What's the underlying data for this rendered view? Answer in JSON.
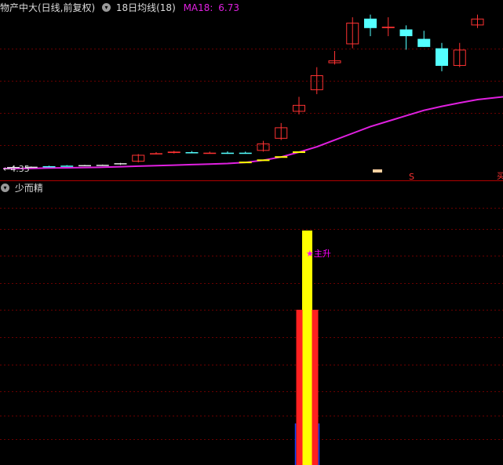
{
  "top_panel": {
    "title": "物产中大(日线,前复权)",
    "indicator_name": "18日均线(18)",
    "ma_label": "MA18:",
    "ma_value": "6.73",
    "price_marker": "←4.35",
    "s_marker": "S",
    "right_marker": "买",
    "ma_color": "#e020e0",
    "up_color": "#ff3232",
    "down_color": "#54ffff"
  },
  "bottom_panel": {
    "title": "少而精",
    "signal_label": "★主升",
    "signal_color": "#ff00ff",
    "bar_colors": {
      "outer": "#ff2020",
      "inner": "#ffff00",
      "base": "#1040ff"
    }
  },
  "icons": {
    "collapse": "chevron-down-icon"
  },
  "chart_data": {
    "type": "candlestick",
    "candles": [
      {
        "o": 4.35,
        "h": 4.36,
        "l": 4.33,
        "c": 4.35,
        "dir": "flat"
      },
      {
        "o": 4.36,
        "h": 4.37,
        "l": 4.34,
        "c": 4.36,
        "dir": "flat"
      },
      {
        "o": 4.37,
        "h": 4.4,
        "l": 4.35,
        "c": 4.38,
        "dir": "down"
      },
      {
        "o": 4.4,
        "h": 4.42,
        "l": 4.38,
        "c": 4.39,
        "dir": "down"
      },
      {
        "o": 4.41,
        "h": 4.43,
        "l": 4.39,
        "c": 4.42,
        "dir": "flat"
      },
      {
        "o": 4.42,
        "h": 4.44,
        "l": 4.4,
        "c": 4.43,
        "dir": "flat"
      },
      {
        "o": 4.45,
        "h": 4.5,
        "l": 4.43,
        "c": 4.49,
        "dir": "flat"
      },
      {
        "o": 4.55,
        "h": 4.83,
        "l": 4.52,
        "c": 4.8,
        "dir": "up"
      },
      {
        "o": 4.85,
        "h": 4.9,
        "l": 4.83,
        "c": 4.86,
        "dir": "up"
      },
      {
        "o": 4.87,
        "h": 4.95,
        "l": 4.85,
        "c": 4.92,
        "dir": "up"
      },
      {
        "o": 4.9,
        "h": 4.94,
        "l": 4.86,
        "c": 4.88,
        "dir": "down"
      },
      {
        "o": 4.88,
        "h": 4.92,
        "l": 4.85,
        "c": 4.87,
        "dir": "up"
      },
      {
        "o": 4.88,
        "h": 4.93,
        "l": 4.84,
        "c": 4.86,
        "dir": "down"
      },
      {
        "o": 4.87,
        "h": 4.92,
        "l": 4.85,
        "c": 4.88,
        "dir": "down"
      },
      {
        "o": 4.95,
        "h": 5.32,
        "l": 4.92,
        "c": 5.22,
        "dir": "up"
      },
      {
        "o": 5.4,
        "h": 5.98,
        "l": 5.35,
        "c": 5.82,
        "dir": "up"
      },
      {
        "o": 6.4,
        "h": 6.95,
        "l": 6.3,
        "c": 6.65,
        "dir": "up"
      },
      {
        "o": 7.2,
        "h": 8.05,
        "l": 7.05,
        "c": 7.75,
        "dir": "up"
      },
      {
        "o": 8.2,
        "h": 8.65,
        "l": 8.15,
        "c": 8.3,
        "dir": "up"
      },
      {
        "o": 8.9,
        "h": 9.9,
        "l": 8.75,
        "c": 9.7,
        "dir": "up"
      },
      {
        "o": 9.85,
        "h": 10.0,
        "l": 9.2,
        "c": 9.5,
        "dir": "down"
      },
      {
        "o": 9.5,
        "h": 9.9,
        "l": 9.2,
        "c": 9.55,
        "dir": "up"
      },
      {
        "o": 9.45,
        "h": 9.6,
        "l": 8.7,
        "c": 9.2,
        "dir": "down"
      },
      {
        "o": 9.1,
        "h": 9.4,
        "l": 8.8,
        "c": 8.8,
        "dir": "down"
      },
      {
        "o": 8.75,
        "h": 8.95,
        "l": 7.9,
        "c": 8.1,
        "dir": "down"
      },
      {
        "o": 8.1,
        "h": 8.95,
        "l": 8.05,
        "c": 8.7,
        "dir": "up"
      },
      {
        "o": 9.6,
        "h": 10.0,
        "l": 9.5,
        "c": 9.85,
        "dir": "up"
      }
    ],
    "ma18": [
      4.29,
      4.3,
      4.31,
      4.32,
      4.33,
      4.34,
      4.36,
      4.38,
      4.4,
      4.42,
      4.44,
      4.46,
      4.48,
      4.52,
      4.6,
      4.72,
      4.9,
      5.1,
      5.35,
      5.6,
      5.85,
      6.05,
      6.25,
      6.45,
      6.6,
      6.73,
      6.85
    ],
    "signal_bar_index": 17
  }
}
